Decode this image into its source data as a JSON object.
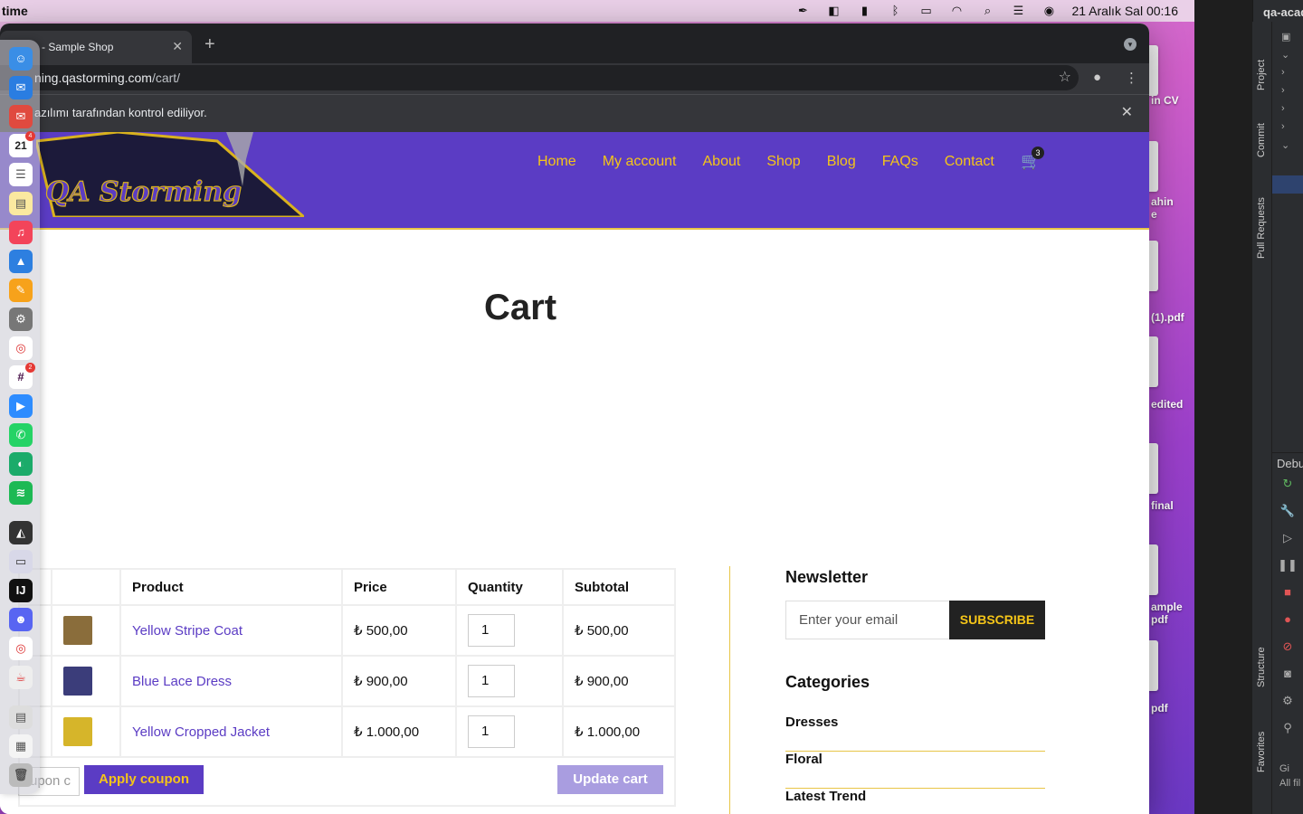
{
  "menubar": {
    "app_name": "time",
    "datetime": "21 Aralık Sal  00:16"
  },
  "desktop_files": [
    {
      "label": "in CV"
    },
    {
      "label": "ahin\ne"
    },
    {
      "label": "(1).pdf"
    },
    {
      "label": "edited"
    },
    {
      "label": "final"
    },
    {
      "label": "ample\npdf"
    },
    {
      "label": "pdf"
    }
  ],
  "ide": {
    "title": "qa-acad",
    "side_tabs": [
      "Project",
      "Commit",
      "Pull Requests",
      "Structure",
      "Favorites"
    ],
    "debug_label": "Debu",
    "bottom_labels": [
      "Gi",
      "All fil"
    ]
  },
  "browser": {
    "tab_title": "- Sample Shop",
    "url_host": "ning.qastorming.com",
    "url_path": "/cart/",
    "infobar_text": "azılımı tarafından kontrol ediliyor."
  },
  "site": {
    "logo_text": "QA Storming",
    "nav": [
      "Home",
      "My account",
      "About",
      "Shop",
      "Blog",
      "FAQs",
      "Contact"
    ],
    "cart_count": "3",
    "page_title": "Cart"
  },
  "cart": {
    "headers": {
      "product": "Product",
      "price": "Price",
      "quantity": "Quantity",
      "subtotal": "Subtotal"
    },
    "items": [
      {
        "product": "Yellow Stripe Coat",
        "price": "₺ 500,00",
        "qty": "1",
        "subtotal": "₺ 500,00",
        "thumb_color": "#8a6d3b"
      },
      {
        "product": "Blue Lace Dress",
        "price": "₺ 900,00",
        "qty": "1",
        "subtotal": "₺ 900,00",
        "thumb_color": "#3b3d7a"
      },
      {
        "product": "Yellow Cropped Jacket",
        "price": "₺ 1.000,00",
        "qty": "1",
        "subtotal": "₺ 1.000,00",
        "thumb_color": "#d6b52a"
      }
    ],
    "coupon_placeholder": "upon c",
    "apply_label": "Apply coupon",
    "update_label": "Update cart"
  },
  "sidebar": {
    "newsletter_title": "Newsletter",
    "email_placeholder": "Enter your email",
    "subscribe_label": "SUBSCRIBE",
    "categories_title": "Categories",
    "categories": [
      "Dresses",
      "Floral",
      "Latest Trend"
    ]
  },
  "dock": {
    "calendar_day": "21",
    "badges": {
      "calendar": "4",
      "slack": "2"
    }
  },
  "colors": {
    "brand_purple": "#5b3cc4",
    "accent_yellow": "#f5c518"
  }
}
